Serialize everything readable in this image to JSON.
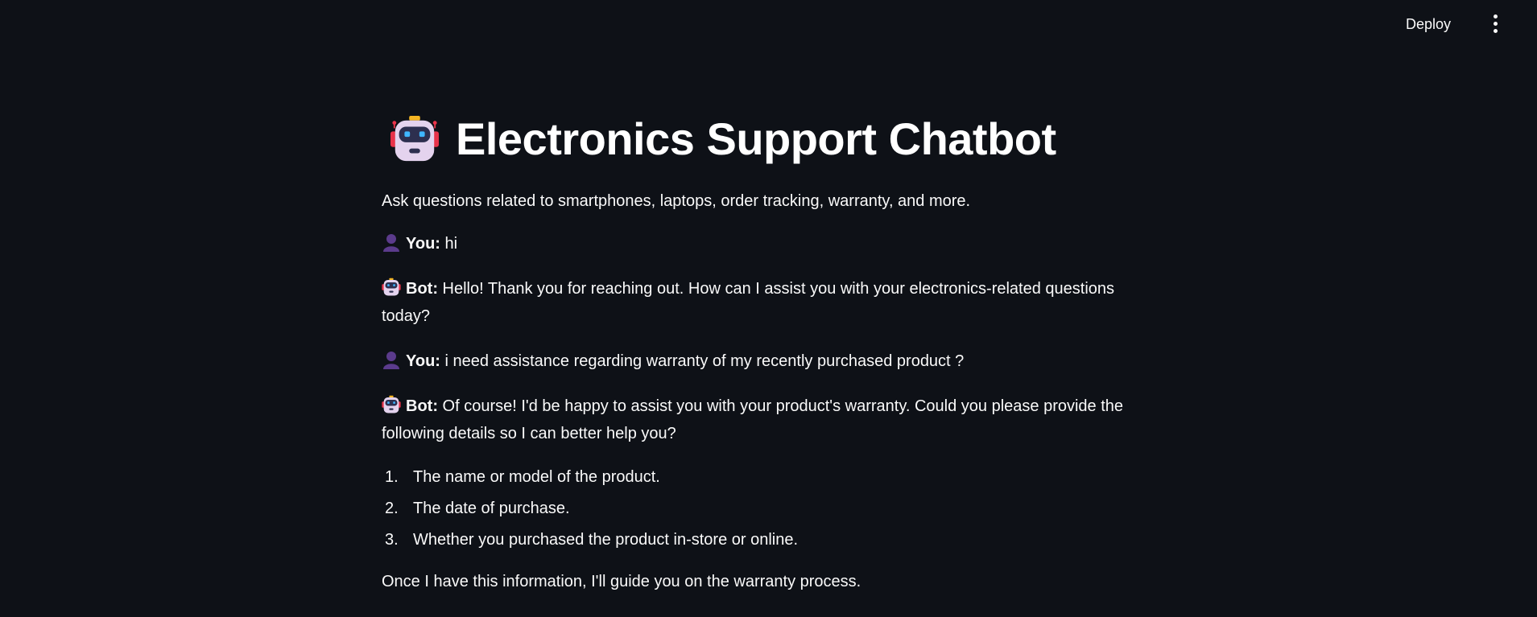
{
  "header": {
    "deploy_label": "Deploy",
    "menu_icon": "kebab-menu-icon"
  },
  "page": {
    "title": "Electronics Support Chatbot",
    "title_icon": "robot-icon",
    "subtitle": "Ask questions related to smartphones, laptops, order tracking, warranty, and more."
  },
  "messages": [
    {
      "role": "You:",
      "icon": "user-silhouette-icon",
      "text": " hi"
    },
    {
      "role": "Bot:",
      "icon": "robot-icon",
      "text": " Hello! Thank you for reaching out. How can I assist you with your electronics-related questions today?"
    },
    {
      "role": "You:",
      "icon": "user-silhouette-icon",
      "text": " i need assistance regarding warranty of my recently purchased product ?"
    },
    {
      "role": "Bot:",
      "icon": "robot-icon",
      "text": " Of course! I'd be happy to assist you with your product's warranty. Could you please provide the following details so I can better help you?"
    }
  ],
  "steps": [
    {
      "num": "1.",
      "text": "The name or model of the product."
    },
    {
      "num": "2.",
      "text": "The date of purchase."
    },
    {
      "num": "3.",
      "text": "Whether you purchased the product in-store or online."
    }
  ],
  "closing": "Once I have this information, I'll guide you on the warranty process.",
  "colors": {
    "background": "#0e1117",
    "text": "#fafafa",
    "user_icon": "#5b3b8c",
    "robot_accent": "#e8334a"
  }
}
